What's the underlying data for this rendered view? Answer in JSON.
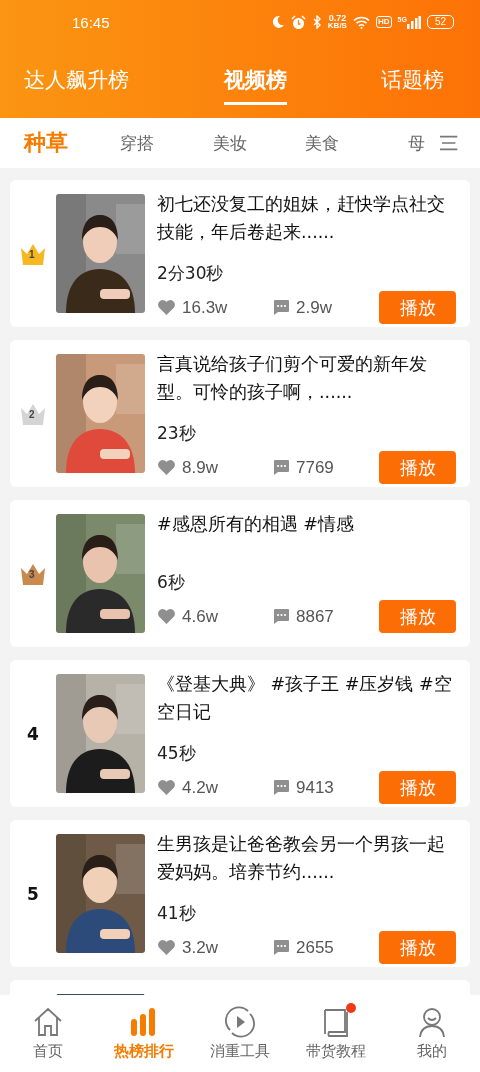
{
  "status_bar": {
    "time": "16:45",
    "net_speed": "0.72",
    "net_unit": "KB/S",
    "hd": "HD",
    "network": "5G",
    "battery": "52"
  },
  "top_tabs": [
    {
      "label": "达人飙升榜",
      "selected": false
    },
    {
      "label": "视频榜",
      "selected": true
    },
    {
      "label": "话题榜",
      "selected": false
    }
  ],
  "categories": [
    {
      "label": "种草",
      "selected": true
    },
    {
      "label": "穿搭",
      "selected": false
    },
    {
      "label": "美妆",
      "selected": false
    },
    {
      "label": "美食",
      "selected": false
    },
    {
      "label": "母",
      "selected": false
    }
  ],
  "cards": [
    {
      "rank": "1",
      "kind": "crown",
      "color": "#f5b820",
      "title": "初七还没复工的姐妹，赶快学点社交技能，年后卷起来......",
      "duration": "2分30秒",
      "likes": "16.3w",
      "comments": "2.9w",
      "button": "播放"
    },
    {
      "rank": "2",
      "kind": "crown",
      "color": "#d4d4d4",
      "title": "言真说给孩子们剪个可爱的新年发型。可怜的孩子啊，......",
      "duration": "23秒",
      "likes": "8.9w",
      "comments": "7769",
      "button": "播放"
    },
    {
      "rank": "3",
      "kind": "crown",
      "color": "#c98a4e",
      "title": "#感恩所有的相遇 #情感",
      "duration": "6秒",
      "likes": "4.6w",
      "comments": "8867",
      "button": "播放"
    },
    {
      "rank": "4",
      "kind": "number",
      "title": "《登基大典》 #孩子王 #压岁钱 #空空日记",
      "duration": "45秒",
      "likes": "4.2w",
      "comments": "9413",
      "button": "播放"
    },
    {
      "rank": "5",
      "kind": "number",
      "title": "生男孩是让爸爸教会另一个男孩一起爱妈妈。培养节约......",
      "duration": "41秒",
      "likes": "3.2w",
      "comments": "2655",
      "button": "播放"
    }
  ],
  "more_below": true,
  "bottom_nav": [
    {
      "label": "首页",
      "selected": false,
      "badge": false
    },
    {
      "label": "热榜排行",
      "selected": true,
      "badge": false
    },
    {
      "label": "消重工具",
      "selected": false,
      "badge": false
    },
    {
      "label": "带货教程",
      "selected": false,
      "badge": true
    },
    {
      "label": "我的",
      "selected": false,
      "badge": false
    }
  ]
}
